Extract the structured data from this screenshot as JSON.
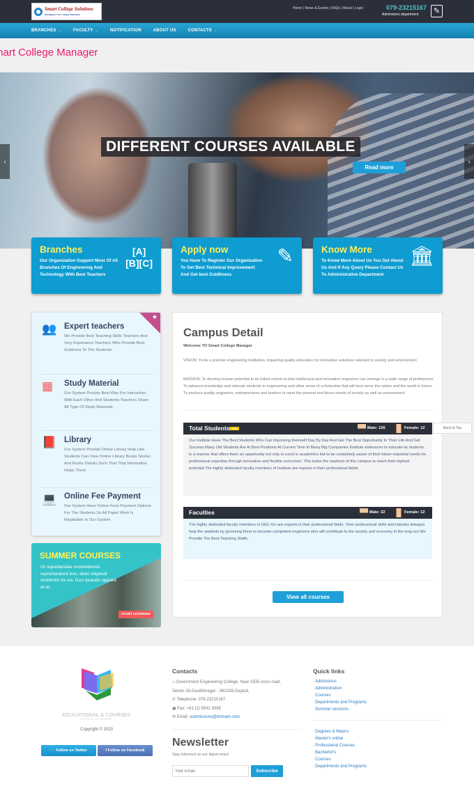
{
  "header": {
    "logo_text": "Smart College Solutions",
    "logo_tagline": "Intelligence For College Education",
    "top_links": [
      "Home",
      "News & Events",
      "FAQs",
      "About",
      "Login"
    ],
    "phone": "079-23215167",
    "phone_label": "Admissions department"
  },
  "nav": [
    {
      "label": "BRANCHES",
      "dropdown": true
    },
    {
      "label": "FACULTY",
      "dropdown": true
    },
    {
      "label": "NOTIFICATION",
      "dropdown": false
    },
    {
      "label": "ABOUT US",
      "dropdown": false
    },
    {
      "label": "CONTACTS",
      "dropdown": true
    }
  ],
  "page_title": "mart College Manager",
  "hero": {
    "title": "DIFFERENT COURSES AVAILABLE",
    "button": "Read more",
    "prev": "‹",
    "next": "›"
  },
  "features": [
    {
      "title": "Branches",
      "text": "Our Organization Support Most Of All Branches Of Enginnering And Technology With Best Teachers",
      "icon": "abc-blocks-icon"
    },
    {
      "title": "Apply now",
      "text": "You Have To Register Our Organization To Get Best Technical Improvement And Get best Guidliness",
      "icon": "highlighter-icon"
    },
    {
      "title": "Know More",
      "text": "To Know More About Us You Get About Us And If Any Query Please Contact Us To Administrative Department",
      "icon": "institution-icon"
    }
  ],
  "services": [
    {
      "title": "Expert teachers",
      "text": "We Provide Best Teaching Skills Teachers And Very Experiance Teachers Who Provide Best Guidness To The Students",
      "icon": "users-icon"
    },
    {
      "title": "Study Material",
      "text": "Our System Provide Best Way For Interaction With Each Other And Students-Teachers Share All Type Of Study Materials",
      "icon": "film-icon"
    },
    {
      "title": "Library",
      "text": "Our System Provide Online Library Help Like Students Can View Online Library Books Stocks And Books Details Such That That Information Helps Them",
      "icon": "book-icon"
    },
    {
      "title": "Online Fee Payment",
      "text": "Our System Have Online Fees Payment Options For The Students So All Paper Work Is Neglatable In Our System",
      "icon": "laptop-icon"
    }
  ],
  "summer": {
    "title": "SUMMER COURSES",
    "text": "Ut repudiandae contentiones reprehendunt eos, diam eligendi inciderint vix ea. Duo quando appare at te.",
    "button": "START LEARNING"
  },
  "campus": {
    "title": "Campus Detail",
    "welcome": "Welcome TO Smart College Manager",
    "vision": "VISION: To be a premier engineering institution, imparting quality education for innovative solutions relevant to society and environment.",
    "mission": "MISSION: To develop human potential to its fullest extent so that intellectual and innovative engineers can emerge in a wide range of professions. To advance knowledge and educate students in engineering and other areas of scholarship that will best serve the nation and the world in future. To produce quality engineers, entrepreneurs and leaders to meet the present and future needs of society as well as environment.",
    "students": {
      "title": "Total Students",
      "badge": "new",
      "male": "Male: 126",
      "female": "Female: 12",
      "text": "Our Institute Have The Best Students Who Can Improving themself Day By Day And Get The Best Opportunity In Thier Life And Get Success.Many Old Students Are At Best Positions At Current Time In Many Big Companies.Institute endeavors to educate its students in a manner that offers them an opportunity not only to excel in academics but to be completely aware of their future industrial needs for professional expertise through innovative and flexible curriculum. This trains the students of this campus to reach their highest potential.The highly dedicated faculty members of Institute are experts in their professional fields."
    },
    "faculties": {
      "title": "Faculties",
      "male": "Male: 22",
      "female": "Female: 12",
      "text": "The highly dedicated faculty members of GEC-Gn are experts in their professional fields. Their professional skills and industry linkages help the students by grooming them to become competent engineers who will contribute to the society and economy in the long run.We Provide The Best Teaching Staffs.."
    },
    "view_all": "View all courses"
  },
  "back_to_top": "Back to Top",
  "footer": {
    "brand": "EDUCATIONAL & COURSES",
    "brand_sub": "premium site template",
    "copyright": "Copyright © 2013",
    "twitter": "Follow on Twitter",
    "facebook": "Follow on Facebook",
    "contacts_title": "Contacts",
    "address1": "Government Engineering College, Near GEB cross road,",
    "address2": "Sector-28,Gandhinagar - 382028,Gujarat.",
    "telephone": "Telephone: 079-23215167",
    "fax": "Fax: +61 (2) 9542 3599",
    "email_label": "Email:",
    "email": "submissions@domain.com",
    "newsletter_title": "Newsletter",
    "newsletter_text": "Stay informed on our latest news!",
    "email_placeholder": "Your Email",
    "subscribe": "Subscribe",
    "quick_title": "Quick links",
    "quick1": [
      "Admissions",
      "Administration",
      "Courses",
      "Departments and Programs",
      "Summer sessions"
    ],
    "quick2": [
      "Degrees & Majors",
      "Master's online",
      "Professional Courses",
      "Bacherlor's",
      "Courses",
      "Departments and Programs"
    ]
  }
}
